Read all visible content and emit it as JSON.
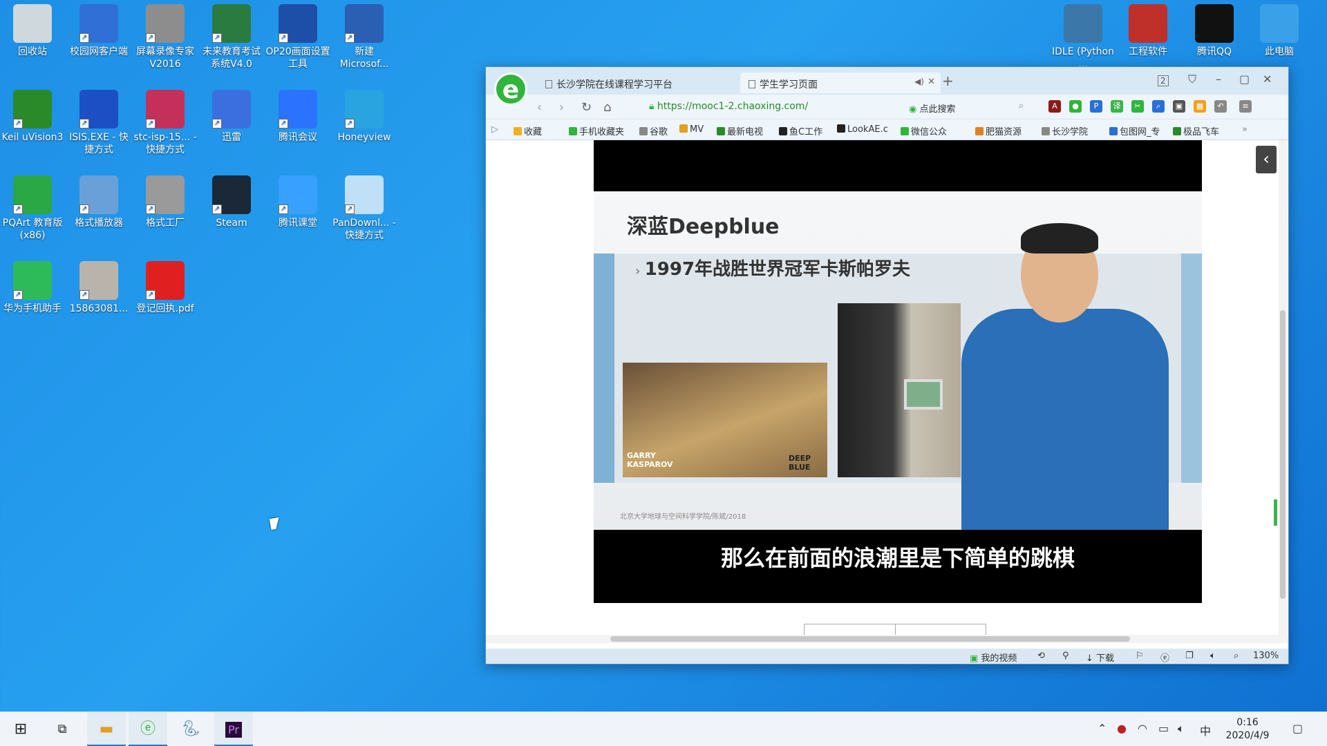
{
  "desktop_left": [
    {
      "label": "回收站",
      "icon": "recycle-bin-icon",
      "color": "#cfd8dc"
    },
    {
      "label": "校园网客户端",
      "icon": "network-client-icon",
      "color": "#2f6fd6"
    },
    {
      "label": "屏幕录像专家V2016",
      "icon": "screen-recorder-icon",
      "color": "#8d8d8d"
    },
    {
      "label": "未来教育考试系统V4.0",
      "icon": "exam-system-icon",
      "color": "#2a7b3f"
    },
    {
      "label": "OP20画面设置工具",
      "icon": "globe-tool-icon",
      "color": "#1d4fa8"
    },
    {
      "label": "新建 Microsof...",
      "icon": "word-doc-icon",
      "color": "#2b5fb4"
    },
    {
      "label": "Keil uVision3",
      "icon": "keil-icon",
      "color": "#2a8a2a"
    },
    {
      "label": "ISIS.EXE - 快捷方式",
      "icon": "isis-icon",
      "color": "#1c4fc4"
    },
    {
      "label": "stc-isp-15... - 快捷方式",
      "icon": "stc-isp-icon",
      "color": "#c4305a"
    },
    {
      "label": "迅雷",
      "icon": "thunder-icon",
      "color": "#3b6fe0"
    },
    {
      "label": "腾讯会议",
      "icon": "tencent-meeting-icon",
      "color": "#2b72ff"
    },
    {
      "label": "Honeyview",
      "icon": "honeyview-icon",
      "color": "#2aa4e0"
    },
    {
      "label": "PQArt 教育版(x86)",
      "icon": "pqart-icon",
      "color": "#2aa845"
    },
    {
      "label": "格式播放器",
      "icon": "format-player-icon",
      "color": "#6aa0d8"
    },
    {
      "label": "格式工厂",
      "icon": "format-factory-icon",
      "color": "#9a9a9a"
    },
    {
      "label": "Steam",
      "icon": "steam-icon",
      "color": "#1b2838"
    },
    {
      "label": "腾讯课堂",
      "icon": "tencent-classroom-icon",
      "color": "#38a0ff"
    },
    {
      "label": "PanDownl... - 快捷方式",
      "icon": "pandownload-icon",
      "color": "#bfe0f6"
    },
    {
      "label": "华为手机助手",
      "icon": "huawei-assistant-icon",
      "color": "#2dbb5a"
    },
    {
      "label": "15863081...",
      "icon": "image-file-icon",
      "color": "#b8b4ac"
    },
    {
      "label": "登记回执.pdf",
      "icon": "pdf-icon",
      "color": "#e02020"
    }
  ],
  "desktop_right": [
    {
      "label": "IDLE (Python ...",
      "icon": "python-idle-icon",
      "color": "#3b77a8"
    },
    {
      "label": "工程软件",
      "icon": "engineering-software-icon",
      "color": "#c0302a"
    },
    {
      "label": "腾讯QQ",
      "icon": "qq-icon",
      "color": "#111111"
    },
    {
      "label": "此电脑",
      "icon": "this-pc-icon",
      "color": "#3aa0e8"
    }
  ],
  "browser": {
    "tabs": [
      "长沙学院在线课程学习平台",
      "学生学习页面"
    ],
    "tab_close": "✕",
    "tab_audio": "◀)",
    "new_tab": "+",
    "badge": "2",
    "url": "https://mooc1-2.chaoxing.com/",
    "search_placeholder": "点此搜索",
    "bookmarks": [
      "收藏",
      "手机收藏夹",
      "谷歌",
      "MV",
      "最新电视",
      "鱼C工作",
      "LookAE.c",
      "微信公众",
      "肥猫资源",
      "长沙学院",
      "包图网_专",
      "极品飞车"
    ],
    "bookmark_more": "»",
    "status": {
      "my_video": "我的视频",
      "download": "下载",
      "zoom": "130%"
    }
  },
  "video": {
    "slide_title": "深蓝Deepblue",
    "slide_bullet": "1997年战胜世界冠军卡斯帕罗夫",
    "photo_caption_left": "GARRY KASPAROV",
    "photo_caption_right": "DEEP BLUE",
    "slide_footer": "北京大学地球与空间科学学院/陈斌/2018",
    "subtitle": "那么在前面的浪潮里是下简单的跳棋"
  },
  "taskbar": {
    "clock_time": "0:16",
    "clock_date": "2020/4/9",
    "ime": "中"
  },
  "colors": {
    "desktop": "#1e8fe6",
    "accent": "#1e7bd0",
    "browser_green": "#2fb53c"
  }
}
